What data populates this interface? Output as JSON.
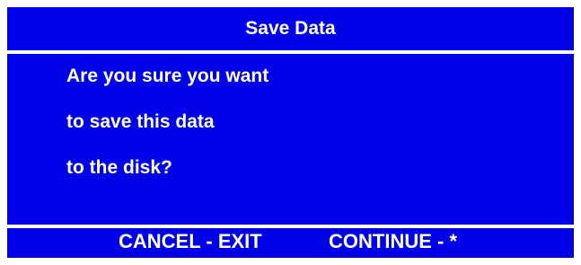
{
  "dialog": {
    "title": "Save Data",
    "message_lines": [
      "Are you sure you want",
      "to save this data",
      "to the disk?"
    ],
    "footer": {
      "cancel_label": "CANCEL - EXIT",
      "continue_label": "CONTINUE - *"
    }
  },
  "colors": {
    "panel_background": "#0000e6",
    "text": "#ffffff",
    "page_background": "#ffffff"
  }
}
